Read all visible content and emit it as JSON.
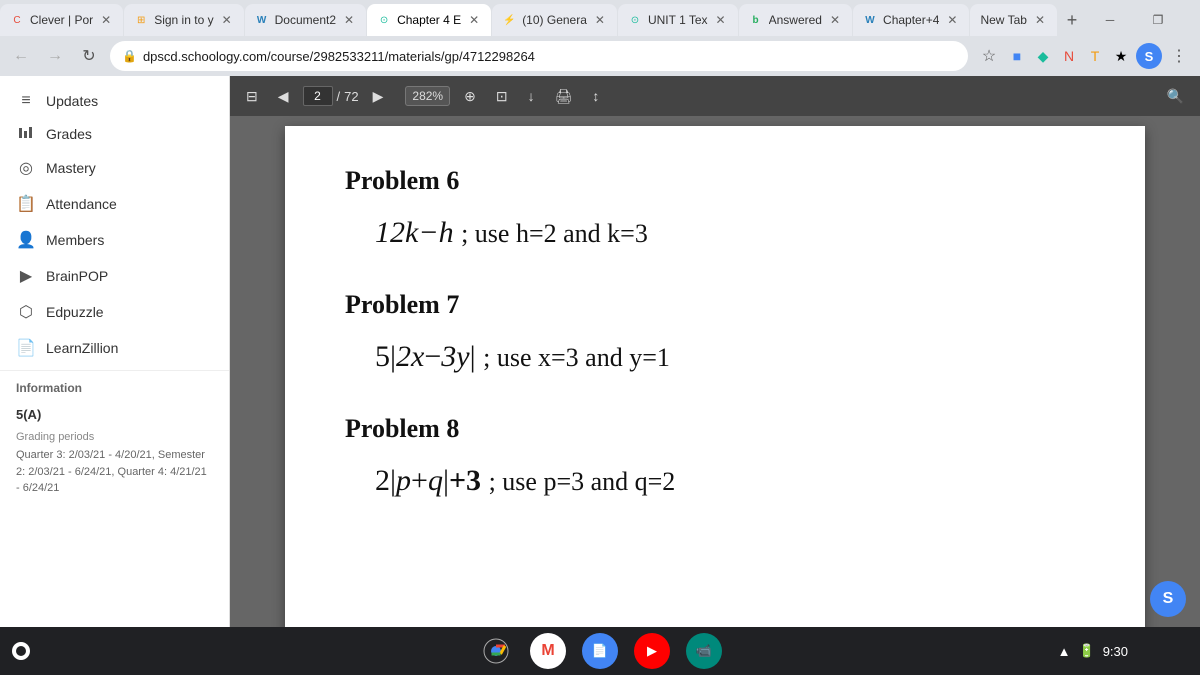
{
  "browser": {
    "tabs": [
      {
        "id": "clever",
        "label": "Clever | Por",
        "favicon": "C",
        "favicon_color": "#e74c3c",
        "active": false
      },
      {
        "id": "signin",
        "label": "Sign in to y",
        "favicon": "⊞",
        "favicon_color": "#f39c12",
        "active": false
      },
      {
        "id": "document",
        "label": "Document2",
        "favicon": "W",
        "favicon_color": "#2980b9",
        "active": false
      },
      {
        "id": "chapter4",
        "label": "Chapter 4 E",
        "favicon": "⊙",
        "favicon_color": "#1abc9c",
        "active": true
      },
      {
        "id": "genially",
        "label": "(10) Genera",
        "favicon": "⚡",
        "favicon_color": "#9b59b6",
        "active": false
      },
      {
        "id": "unit1",
        "label": "UNIT 1 Tex",
        "favicon": "⊙",
        "favicon_color": "#1abc9c",
        "active": false
      },
      {
        "id": "brainly",
        "label": "Answered",
        "favicon": "b",
        "favicon_color": "#27ae60",
        "active": false
      },
      {
        "id": "chapter4w",
        "label": "Chapter+4",
        "favicon": "W",
        "favicon_color": "#2980b9",
        "active": false
      },
      {
        "id": "newtab",
        "label": "New Tab",
        "favicon": "",
        "favicon_color": "#555",
        "active": false
      }
    ],
    "url": "dpscd.schoology.com/course/2982533211/materials/gp/4712298264",
    "back_enabled": true,
    "forward_enabled": false
  },
  "sidebar": {
    "items": [
      {
        "id": "updates",
        "label": "Updates",
        "icon": "≡"
      },
      {
        "id": "grades",
        "label": "Grades",
        "icon": "📊"
      },
      {
        "id": "mastery",
        "label": "Mastery",
        "icon": "◎"
      },
      {
        "id": "attendance",
        "label": "Attendance",
        "icon": "📋"
      },
      {
        "id": "members",
        "label": "Members",
        "icon": "👤"
      },
      {
        "id": "brainpop",
        "label": "BrainPOP",
        "icon": "▶"
      },
      {
        "id": "edpuzzle",
        "label": "Edpuzzle",
        "icon": "⬡"
      },
      {
        "id": "learnzillion",
        "label": "LearnZillion",
        "icon": "📄"
      }
    ],
    "information": {
      "section": "Information",
      "grade": "5(A)",
      "grading_periods_label": "Grading periods",
      "grading_periods": "Quarter 3: 2/03/21 - 4/20/21, Semester 2: 2/03/21 - 6/24/21, Quarter 4: 4/21/21 - 6/24/21"
    }
  },
  "pdf_toolbar": {
    "page_current": "2",
    "page_total": "72",
    "zoom": "282%",
    "icons": [
      "◀",
      "▶",
      "⊟",
      "↓",
      "↕"
    ]
  },
  "problems": [
    {
      "id": "problem6",
      "title": "Problem 6",
      "expression": "12k−h",
      "instruction": "; use h=2 and k=3"
    },
    {
      "id": "problem7",
      "title": "Problem 7",
      "expression": "5|2x−3y|",
      "instruction": "; use x=3 and y=1"
    },
    {
      "id": "problem8",
      "title": "Problem 8",
      "expression": "2|p+q|+3",
      "instruction": "; use p=3 and q=2"
    }
  ],
  "taskbar": {
    "time": "9:30",
    "icons": [
      {
        "id": "chrome",
        "symbol": "🌐"
      },
      {
        "id": "gmail",
        "symbol": "M"
      },
      {
        "id": "docs",
        "symbol": "📄"
      },
      {
        "id": "youtube",
        "symbol": "▶"
      },
      {
        "id": "meet",
        "symbol": "📹"
      }
    ],
    "user_initial": "S",
    "battery": "▲",
    "wifi": "▲"
  }
}
